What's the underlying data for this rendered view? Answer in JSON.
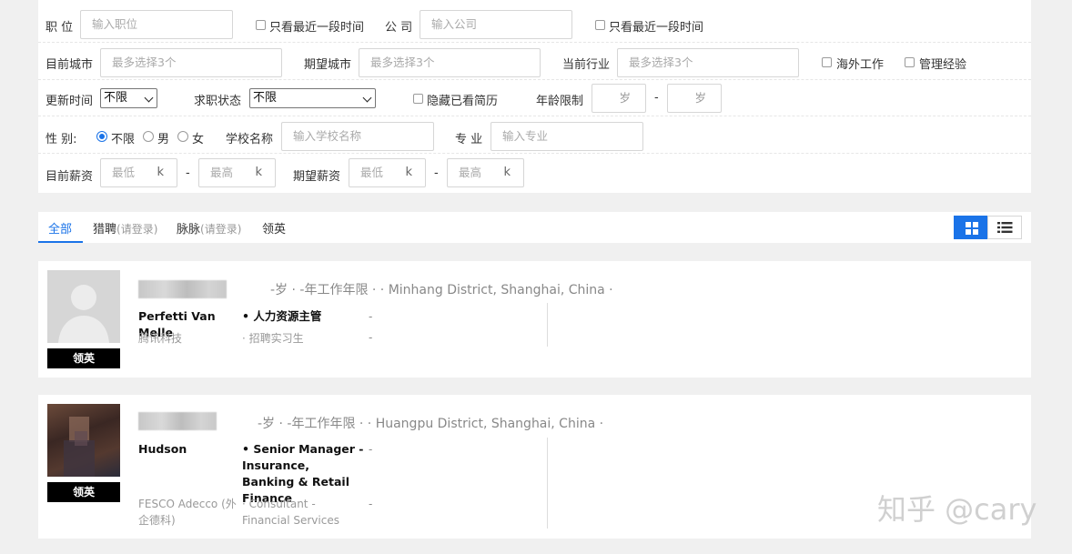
{
  "filters": {
    "position": {
      "label": "职 位",
      "placeholder": "输入职位",
      "recent_only": "只看最近一段时间"
    },
    "company": {
      "label": "公 司",
      "placeholder": "输入公司",
      "recent_only": "只看最近一段时间"
    },
    "current_city": {
      "label": "目前城市",
      "placeholder": "最多选择3个"
    },
    "expected_city": {
      "label": "期望城市",
      "placeholder": "最多选择3个"
    },
    "current_industry": {
      "label": "当前行业",
      "placeholder": "最多选择3个"
    },
    "overseas_work": "海外工作",
    "management_exp": "管理经验",
    "update_time": {
      "label": "更新时间",
      "value": "不限"
    },
    "job_status": {
      "label": "求职状态",
      "value": "不限"
    },
    "hide_viewed": "隐藏已看简历",
    "age_limit": {
      "label": "年龄限制",
      "unit": "岁",
      "separator": "-"
    },
    "gender": {
      "label": "性 别:",
      "options": [
        "不限",
        "男",
        "女"
      ],
      "selected": "不限"
    },
    "school": {
      "label": "学校名称",
      "placeholder": "输入学校名称"
    },
    "major": {
      "label": "专 业",
      "placeholder": "输入专业"
    },
    "current_salary": {
      "label": "目前薪资",
      "min": "最低",
      "max": "最高",
      "unit": "k",
      "separator": "-"
    },
    "expected_salary": {
      "label": "期望薪资",
      "min": "最低",
      "max": "最高",
      "unit": "k",
      "separator": "-"
    }
  },
  "tabs": [
    {
      "label": "全部",
      "sub": "",
      "active": true
    },
    {
      "label": "猎聘",
      "sub": "(请登录)",
      "active": false
    },
    {
      "label": "脉脉",
      "sub": "(请登录)",
      "active": false
    },
    {
      "label": "领英",
      "sub": "",
      "active": false
    }
  ],
  "view_modes": [
    "grid-icon",
    "list-icon"
  ],
  "results": [
    {
      "source_tag": "领英",
      "meta": "-岁 · -年工作年限 · · Minhang District, Shanghai, China ·",
      "company": "Perfetti Van Melle",
      "position": "• 人力资源主管",
      "dash1": "-",
      "sub_company": "腾讯科技",
      "sub_position": "· 招聘实习生",
      "dash2": "-"
    },
    {
      "source_tag": "领英",
      "meta": "-岁 · -年工作年限 · · Huangpu District, Shanghai, China ·",
      "company": "Hudson",
      "position": "• Senior Manager - Insurance, Banking & Retail Finance",
      "dash1": "-",
      "sub_company": "FESCO Adecco (外企德科)",
      "sub_position": "· Consultant - Financial Services",
      "dash2": "-"
    }
  ],
  "watermark": "知乎 @cary",
  "colors": {
    "accent": "#1a73e8",
    "tag_bg": "#000000"
  }
}
